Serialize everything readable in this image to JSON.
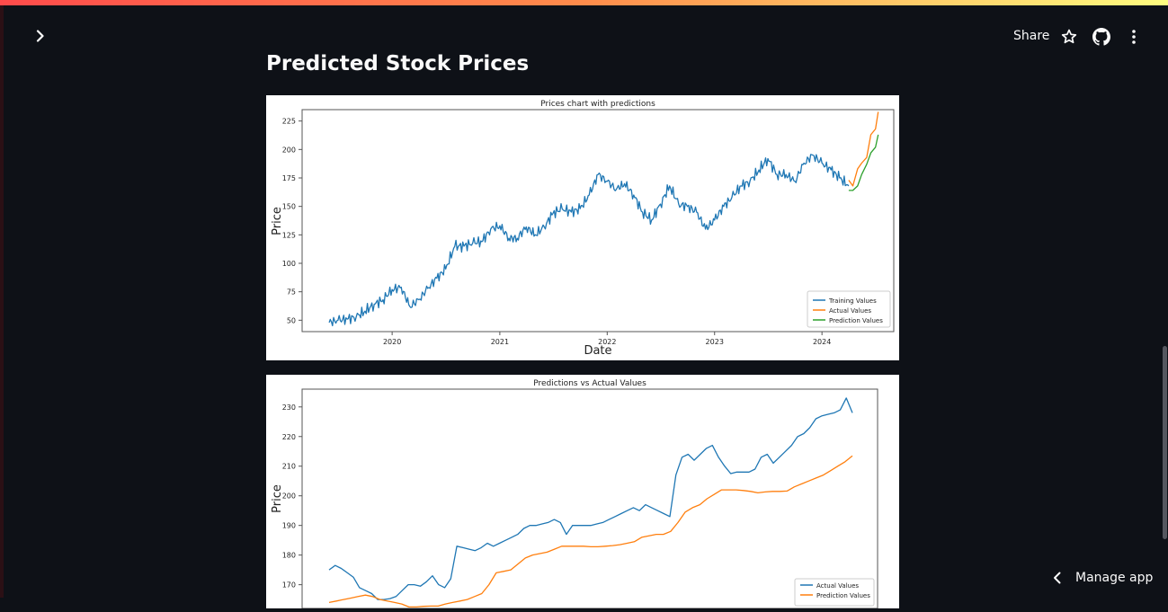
{
  "header": {
    "share_label": "Share",
    "icons": [
      "chevron-right-icon",
      "star-icon",
      "github-icon",
      "more-vertical-icon"
    ]
  },
  "page": {
    "title": "Predicted Stock Prices"
  },
  "footer": {
    "manage_app_label": "Manage app"
  },
  "colors": {
    "background": "#0e1117",
    "training": "#1f77b4",
    "actual": "#ff7f0e",
    "prediction": "#2ca02c"
  },
  "chart_data": [
    {
      "type": "line",
      "title": "Prices chart with predictions",
      "xlabel": "Date",
      "ylabel": "Price",
      "x_ticks": [
        "2020",
        "2021",
        "2022",
        "2023",
        "2024"
      ],
      "y_ticks": [
        50,
        75,
        100,
        125,
        150,
        175,
        200,
        225
      ],
      "xlim": [
        "2019-03-01",
        "2024-09-01"
      ],
      "ylim": [
        40,
        235
      ],
      "legend_position": "lower-right",
      "series": [
        {
          "name": "Training Values",
          "color": "#1f77b4",
          "x": [
            "2019-06-01",
            "2019-07-01",
            "2019-08-01",
            "2019-09-01",
            "2019-10-01",
            "2019-11-01",
            "2019-12-01",
            "2020-01-01",
            "2020-02-01",
            "2020-03-01",
            "2020-04-01",
            "2020-05-01",
            "2020-06-01",
            "2020-07-01",
            "2020-08-01",
            "2020-09-01",
            "2020-10-01",
            "2020-11-01",
            "2020-12-01",
            "2021-01-01",
            "2021-02-01",
            "2021-03-01",
            "2021-04-01",
            "2021-05-01",
            "2021-06-01",
            "2021-07-01",
            "2021-08-01",
            "2021-09-01",
            "2021-10-01",
            "2021-11-01",
            "2021-12-01",
            "2022-01-01",
            "2022-02-01",
            "2022-03-01",
            "2022-04-01",
            "2022-05-01",
            "2022-06-01",
            "2022-07-01",
            "2022-08-01",
            "2022-09-01",
            "2022-10-01",
            "2022-11-01",
            "2022-12-01",
            "2023-01-01",
            "2023-02-01",
            "2023-03-01",
            "2023-04-01",
            "2023-05-01",
            "2023-06-01",
            "2023-07-01",
            "2023-08-01",
            "2023-09-01",
            "2023-10-01",
            "2023-11-01",
            "2023-12-01",
            "2024-01-01",
            "2024-02-01",
            "2024-03-01",
            "2024-04-01"
          ],
          "values": [
            48,
            50,
            51,
            53,
            58,
            64,
            68,
            77,
            79,
            62,
            68,
            78,
            87,
            95,
            115,
            115,
            118,
            119,
            130,
            133,
            122,
            122,
            132,
            125,
            132,
            144,
            148,
            145,
            148,
            160,
            178,
            172,
            165,
            170,
            160,
            145,
            138,
            152,
            168,
            152,
            150,
            145,
            130,
            138,
            150,
            158,
            168,
            172,
            182,
            192,
            178,
            178,
            172,
            188,
            195,
            188,
            182,
            175,
            168
          ]
        },
        {
          "name": "Actual Values",
          "color": "#ff7f0e",
          "x": [
            "2024-04-01",
            "2024-04-15",
            "2024-05-01",
            "2024-05-15",
            "2024-06-01",
            "2024-06-15",
            "2024-07-01",
            "2024-07-10"
          ],
          "values": [
            173,
            168,
            183,
            188,
            193,
            213,
            218,
            233
          ]
        },
        {
          "name": "Prediction Values",
          "color": "#2ca02c",
          "x": [
            "2024-04-01",
            "2024-04-15",
            "2024-05-01",
            "2024-05-15",
            "2024-06-01",
            "2024-06-15",
            "2024-07-01",
            "2024-07-10"
          ],
          "values": [
            164,
            164,
            168,
            178,
            187,
            197,
            202,
            213
          ]
        }
      ]
    },
    {
      "type": "line",
      "title": "Predictions vs Actual Values",
      "xlabel": "",
      "ylabel": "Price",
      "y_ticks": [
        170,
        180,
        190,
        200,
        210,
        220,
        230
      ],
      "ylim": [
        162,
        236
      ],
      "legend_position": "lower-right",
      "series": [
        {
          "name": "Actual Values",
          "color": "#1f77b4",
          "values": [
            175,
            176.5,
            175.5,
            174,
            172.5,
            169,
            168,
            167,
            165,
            165,
            165.3,
            166,
            168,
            170,
            170,
            169.5,
            171,
            173,
            170,
            169,
            172,
            183,
            182.5,
            182,
            181.5,
            182.5,
            184,
            183,
            184,
            185,
            186,
            187,
            189,
            190,
            190,
            190.5,
            191,
            192,
            191,
            187,
            190,
            190,
            190,
            190,
            190.5,
            191,
            192,
            193,
            194,
            195,
            196,
            195,
            197,
            196,
            195,
            194,
            193,
            207,
            213,
            214,
            212,
            214,
            216,
            217,
            213,
            210,
            207.5,
            208,
            208,
            208,
            209,
            213,
            214,
            211,
            213,
            215,
            217,
            220,
            221,
            223,
            226,
            227,
            227.5,
            228,
            229,
            233,
            228
          ]
        },
        {
          "name": "Prediction Values",
          "color": "#ff7f0e",
          "values": [
            164,
            164.5,
            165,
            165.5,
            166,
            166.5,
            166,
            165,
            164.5,
            164,
            163.5,
            162.5,
            162.5,
            162.7,
            162.8,
            162.8,
            163.5,
            164,
            164.5,
            165,
            166,
            167,
            170,
            174,
            174.5,
            175,
            177,
            179,
            180,
            180.5,
            181,
            182,
            183,
            183,
            183,
            183,
            182.8,
            182.8,
            183,
            183.2,
            183.5,
            184,
            184.5,
            186,
            186.5,
            187,
            187,
            188,
            191,
            194.5,
            196,
            197,
            199,
            200.5,
            202,
            202,
            202,
            201.8,
            201.5,
            201,
            201.3,
            201.5,
            201.5,
            201.6,
            203,
            204,
            205,
            206,
            207,
            208.5,
            210,
            211.5,
            213.5
          ]
        }
      ]
    }
  ]
}
